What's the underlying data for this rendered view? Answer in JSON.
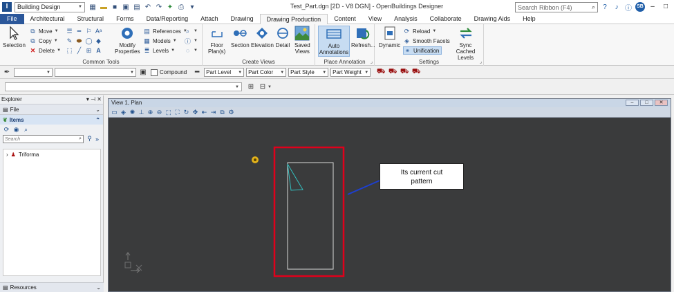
{
  "titlebar": {
    "workflow": "Building Design",
    "window_title": "Test_Part.dgn [2D - V8 DGN] - OpenBuildings Designer",
    "search_placeholder": "Search Ribbon (F4)",
    "user_initials": "SB"
  },
  "tabs": [
    "File",
    "Architectural",
    "Structural",
    "Forms",
    "Data/Reporting",
    "Attach",
    "Drawing",
    "Drawing Production",
    "Content",
    "View",
    "Analysis",
    "Collaborate",
    "Drawing Aids",
    "Help"
  ],
  "active_tab": "Drawing Production",
  "ribbon": {
    "common_tools": {
      "label": "Common Tools",
      "selection": "Selection",
      "move": "Move",
      "copy": "Copy",
      "delete": "Delete",
      "modify_properties_1": "Modify",
      "modify_properties_2": "Properties",
      "references": "References",
      "models": "Models",
      "levels": "Levels"
    },
    "create_views": {
      "label": "Create Views",
      "floor_plans_1": "Floor",
      "floor_plans_2": "Plan(s)",
      "section": "Section",
      "elevation": "Elevation",
      "detail": "Detail",
      "saved_views_1": "Saved",
      "saved_views_2": "Views"
    },
    "place_annotation": {
      "label": "Place Annotation",
      "auto_annotations_1": "Auto",
      "auto_annotations_2": "Annotations",
      "refresh": "Refresh..."
    },
    "settings": {
      "label": "Settings",
      "dynamic": "Dynamic",
      "reload": "Reload",
      "smooth_facets": "Smooth Facets",
      "unification": "Unification",
      "sync_cached_1": "Sync",
      "sync_cached_2": "Cached Levels"
    }
  },
  "attributes": {
    "compound": "Compound",
    "part_level": "Part Level",
    "part_color": "Part Color",
    "part_style": "Part Style",
    "part_weight": "Part Weight"
  },
  "explorer": {
    "title": "Explorer",
    "file_section": "File",
    "items_section": "Items",
    "search_placeholder": "Search",
    "tree_root": "Triforma",
    "resources": "Resources"
  },
  "view": {
    "title": "View 1, Plan"
  },
  "callout": {
    "line1": "Its current cut",
    "line2": "pattern"
  },
  "colors": {
    "highlight_box": "#e0001b",
    "arrow": "#1d3fd0",
    "canvas_bg": "#3a3b3c",
    "element_cyan": "#33c0c0"
  }
}
